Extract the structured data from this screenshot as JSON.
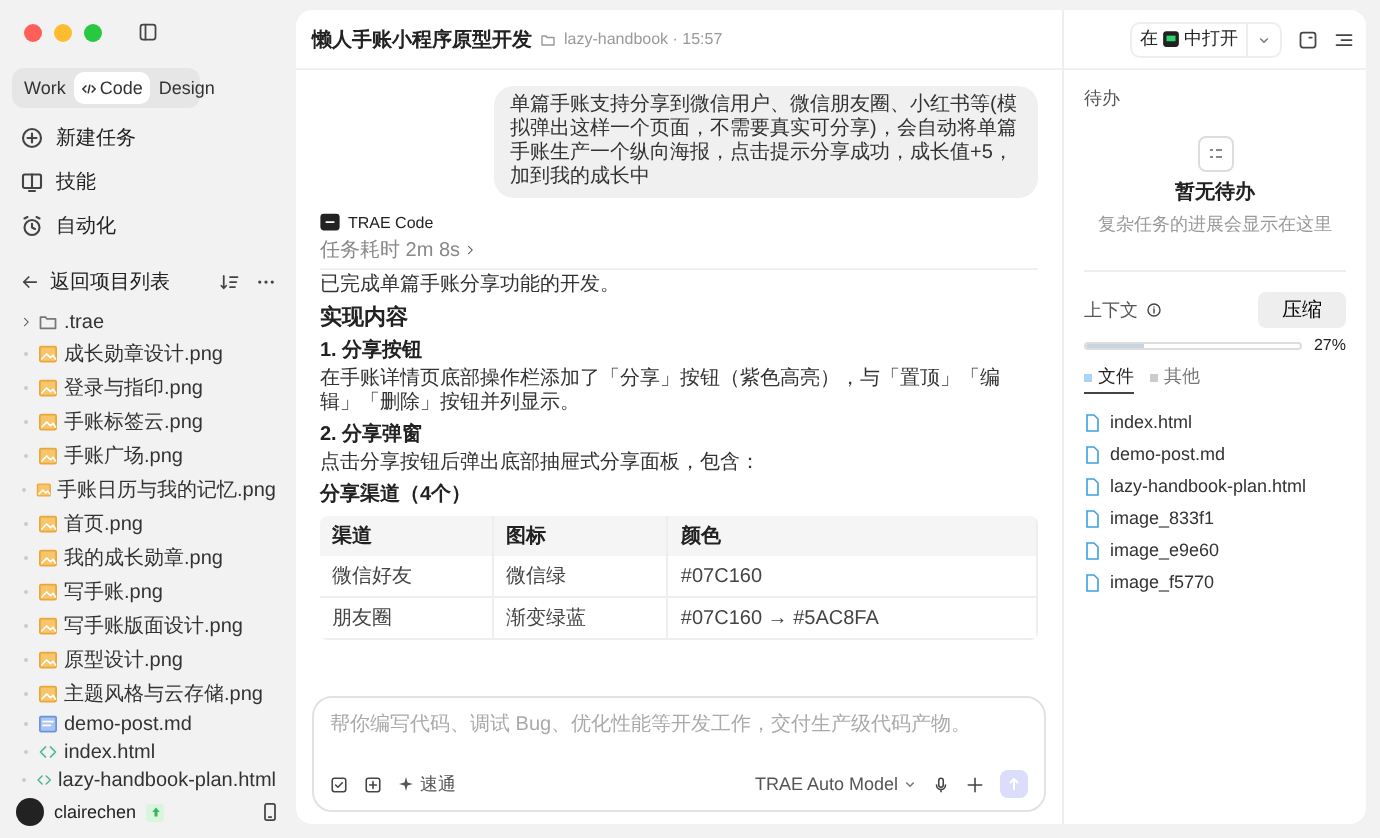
{
  "sidebar": {
    "modes": [
      {
        "label": "Work",
        "selected": false
      },
      {
        "label": "Code",
        "selected": true
      },
      {
        "label": "Design",
        "selected": false
      }
    ],
    "nav": [
      {
        "label": "新建任务"
      },
      {
        "label": "技能"
      },
      {
        "label": "自动化"
      }
    ],
    "back": "返回项目列表",
    "files": [
      {
        "name": ".trae",
        "kind": "folder",
        "expanded": false
      },
      {
        "name": "成长勋章设计.png",
        "kind": "image"
      },
      {
        "name": "登录与指印.png",
        "kind": "image"
      },
      {
        "name": "手账标签云.png",
        "kind": "image"
      },
      {
        "name": "手账广场.png",
        "kind": "image"
      },
      {
        "name": "手账日历与我的记忆.png",
        "kind": "image"
      },
      {
        "name": "首页.png",
        "kind": "image"
      },
      {
        "name": "我的成长勋章.png",
        "kind": "image"
      },
      {
        "name": "写手账.png",
        "kind": "image"
      },
      {
        "name": "写手账版面设计.png",
        "kind": "image"
      },
      {
        "name": "原型设计.png",
        "kind": "image"
      },
      {
        "name": "主题风格与云存储.png",
        "kind": "image"
      },
      {
        "name": "demo-post.md",
        "kind": "markdown"
      },
      {
        "name": "index.html",
        "kind": "code"
      },
      {
        "name": "lazy-handbook-plan.html",
        "kind": "code"
      }
    ],
    "user": {
      "name": "clairechen"
    }
  },
  "chat": {
    "title": "懒人手账小程序原型开发",
    "project": "lazy-handbook · 15:57",
    "user_message": "单篇手账支持分享到微信用户、微信朋友圈、小红书等(模拟弹出这样一个页面，不需要真实可分享)，会自动将单篇手账生产一个纵向海报，点击提示分享成功，成长值+5，加到我的成长中",
    "agent": "TRAE Code",
    "duration": "任务耗时 2m 8s",
    "blocks": [
      {
        "kind": "p",
        "text": "已完成单篇手账分享功能的开发。"
      },
      {
        "kind": "h2",
        "text": "实现内容"
      },
      {
        "kind": "h3",
        "text": "1. 分享按钮"
      },
      {
        "kind": "p",
        "text": "在手账详情页底部操作栏添加了「分享」按钮（紫色高亮），与「置顶」「编辑」「删除」按钮并列显示。"
      },
      {
        "kind": "h3",
        "text": "2. 分享弹窗"
      },
      {
        "kind": "p",
        "text": "点击分享按钮后弹出底部抽屉式分享面板，包含："
      },
      {
        "kind": "strong",
        "text": "分享渠道（4个）"
      }
    ],
    "table": {
      "columns": [
        "渠道",
        "图标",
        "颜色"
      ],
      "rows": [
        [
          "微信好友",
          "微信绿",
          "#07C160"
        ],
        [
          "朋友圈",
          "渐变绿蓝",
          "#07C160 → #5AC8FA"
        ]
      ]
    },
    "composer": {
      "placeholder": "帮你编写代码、调试 Bug、优化性能等开发工作，交付生产级代码产物。",
      "mode": "速通",
      "model": "TRAE Auto Model"
    }
  },
  "panel": {
    "open_in": {
      "prefix": "在",
      "suffix": "中打开"
    },
    "todo": {
      "title": "待办",
      "empty_title": "暂无待办",
      "empty_hint": "复杂任务的进展会显示在这里"
    },
    "context": {
      "title": "上下文",
      "compress": "压缩",
      "level": 0.27,
      "percent": "27%",
      "tabs": [
        {
          "label": "文件",
          "selected": true
        },
        {
          "label": "其他",
          "selected": false
        }
      ],
      "files": [
        "index.html",
        "demo-post.md",
        "lazy-handbook-plan.html",
        "image_833f1",
        "image_e9e60",
        "image_f5770"
      ]
    }
  }
}
